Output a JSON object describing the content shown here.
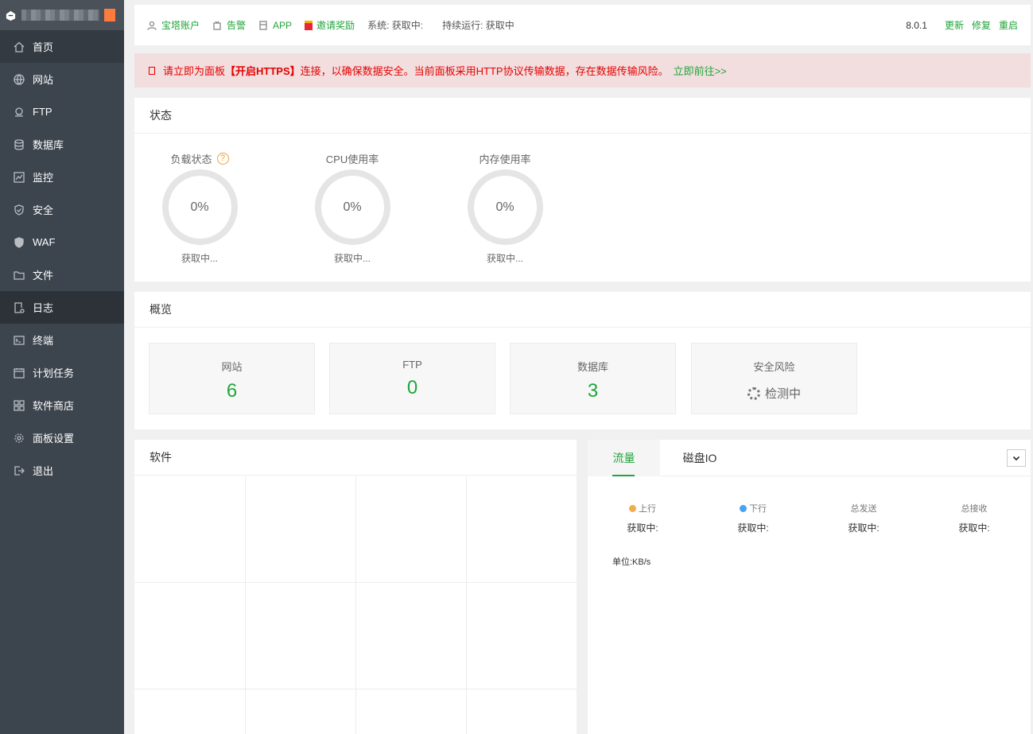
{
  "sidebar": {
    "items": [
      {
        "label": "首页",
        "icon": "home-icon"
      },
      {
        "label": "网站",
        "icon": "globe-icon"
      },
      {
        "label": "FTP",
        "icon": "ftp-icon"
      },
      {
        "label": "数据库",
        "icon": "database-icon"
      },
      {
        "label": "监控",
        "icon": "monitor-icon"
      },
      {
        "label": "安全",
        "icon": "shield-icon"
      },
      {
        "label": "WAF",
        "icon": "waf-shield-icon"
      },
      {
        "label": "文件",
        "icon": "folder-icon"
      },
      {
        "label": "日志",
        "icon": "log-icon"
      },
      {
        "label": "终端",
        "icon": "terminal-icon"
      },
      {
        "label": "计划任务",
        "icon": "calendar-icon"
      },
      {
        "label": "软件商店",
        "icon": "grid-icon"
      },
      {
        "label": "面板设置",
        "icon": "gear-icon"
      },
      {
        "label": "退出",
        "icon": "logout-icon"
      }
    ]
  },
  "topbar": {
    "account": "宝塔账户",
    "alarm": "告警",
    "app": "APP",
    "invite": "邀请奖励",
    "system": "系统:  获取中:",
    "uptime": "持续运行: 获取中",
    "version": "8.0.1",
    "update": "更新",
    "repair": "修复",
    "restart": "重启"
  },
  "alert": {
    "pre": "请立即为面板",
    "bold": "【开启HTTPS】",
    "post": "连接，以确保数据安全。当前面板采用HTTP协议传输数据，存在数据传输风险。",
    "link": "立即前往>>"
  },
  "status": {
    "title": "状态",
    "gauges": [
      {
        "title": "负载状态",
        "value": "0%",
        "sub": "获取中..."
      },
      {
        "title": "CPU使用率",
        "value": "0%",
        "sub": "获取中..."
      },
      {
        "title": "内存使用率",
        "value": "0%",
        "sub": "获取中..."
      }
    ],
    "help": "?"
  },
  "overview": {
    "title": "概览",
    "cards": [
      {
        "label": "网站",
        "value": "6"
      },
      {
        "label": "FTP",
        "value": "0"
      },
      {
        "label": "数据库",
        "value": "3"
      },
      {
        "label": "安全风险",
        "value": "检测中"
      }
    ]
  },
  "software": {
    "title": "软件"
  },
  "traffic": {
    "tabs": [
      "流量",
      "磁盘IO"
    ],
    "stats": [
      {
        "label": "上行",
        "value": "获取中:"
      },
      {
        "label": "下行",
        "value": "获取中:"
      },
      {
        "label": "总发送",
        "value": "获取中:"
      },
      {
        "label": "总接收",
        "value": "获取中:"
      }
    ],
    "unit": "单位:KB/s"
  },
  "colors": {
    "accent": "#20a53a",
    "sidebar": "#3c444d",
    "alert_bg": "#f2dede",
    "alert_text": "#e60000",
    "up_dot": "#f0ad4e",
    "down_dot": "#4aa3f0"
  }
}
